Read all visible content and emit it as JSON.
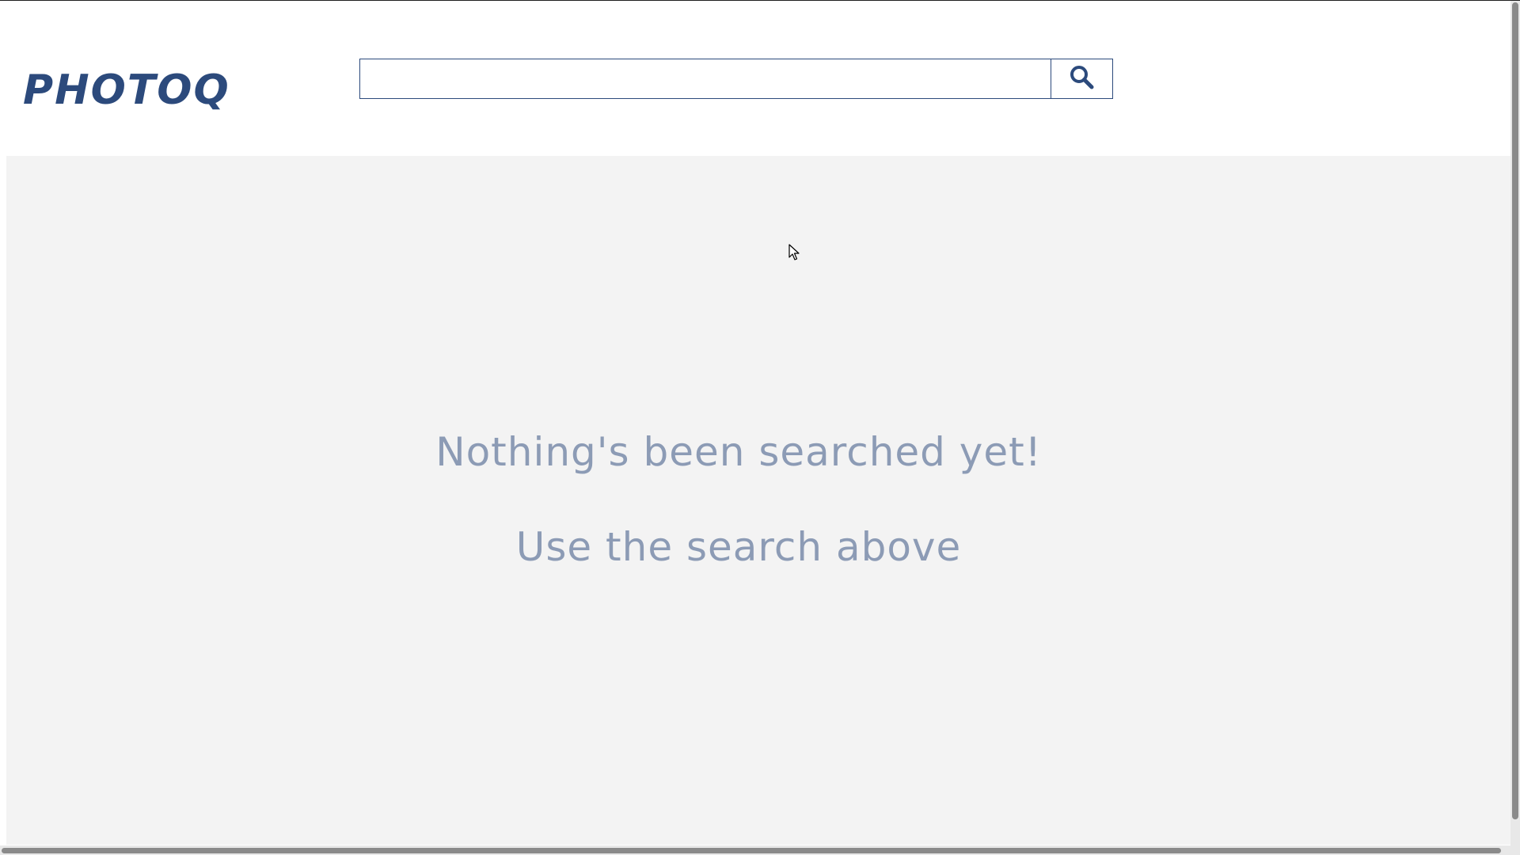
{
  "header": {
    "logo_text": "PHOTOQ",
    "search": {
      "value": "",
      "placeholder": "",
      "button_icon": "search-icon"
    }
  },
  "main": {
    "empty_title": "Nothing's been searched yet!",
    "empty_hint": "Use the search above"
  },
  "colors": {
    "brand": "#2c4a7c",
    "muted_text": "#8c9bb5",
    "content_bg": "#f3f3f3"
  }
}
